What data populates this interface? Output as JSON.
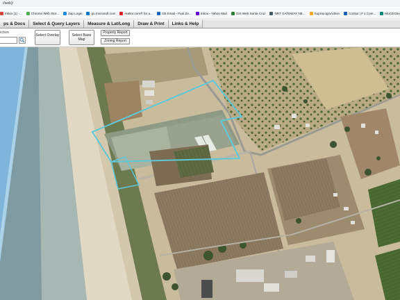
{
  "browser": {
    "url_fragment": "//web)/",
    "bookmarks": [
      {
        "label": "Inbox (1) -...",
        "color": "#d44638"
      },
      {
        "label": "Chrome Web Stor...",
        "color": "#4caf50"
      },
      {
        "label": "Zap Login",
        "color": "#1e88e5"
      },
      {
        "label": "go.microsoft.com",
        "color": "#0078d4"
      },
      {
        "label": "realtor.com® for a...",
        "color": "#d92228"
      },
      {
        "label": "CB Email - Paul.Ze...",
        "color": "#1565c0"
      },
      {
        "label": "Inbox - Yahoo Mail",
        "color": "#6001d2"
      },
      {
        "label": "GIS Web Santa Cruz",
        "color": "#2e7d32"
      },
      {
        "label": "NRT GATEWAY NE...",
        "color": "#455a64"
      },
      {
        "label": "SupraLoginAdmin",
        "color": "#f9a825"
      },
      {
        "label": "CoStar | # 1 Com...",
        "color": "#1565c0"
      },
      {
        "label": "MoCEGbox",
        "color": "#00897b"
      },
      {
        "label": "zipForm®Plus 10 T...",
        "color": "#c62828"
      },
      {
        "label": "Contact Suppo",
        "color": "#555555"
      }
    ]
  },
  "menu": {
    "tabs": [
      "ps & Docs",
      "Select & Query Layers",
      "Measure & Lat/Long",
      "Draw & Print",
      "Links & Help"
    ]
  },
  "toolbar": {
    "jurisdiction_label": "iction",
    "jurisdiction_value": "",
    "select_overlay": "Select Overlay",
    "select_base_map": "Select Base Map",
    "property_report": "Property Report",
    "zoning_report": "Zoning Report"
  },
  "map": {
    "selection_color": "#5fc8d8",
    "ocean_color": "#7fb5da"
  }
}
